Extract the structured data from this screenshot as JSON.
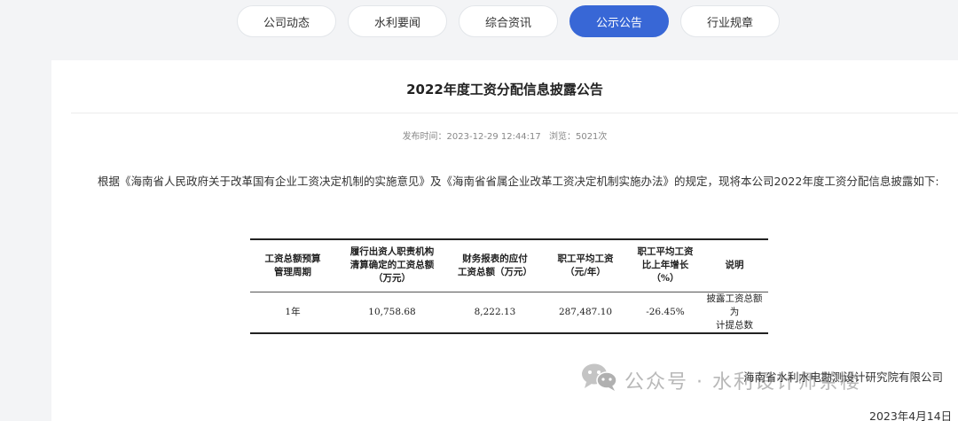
{
  "tabs": [
    {
      "label": "公司动态",
      "active": false
    },
    {
      "label": "水利要闻",
      "active": false
    },
    {
      "label": "综合资讯",
      "active": false
    },
    {
      "label": "公示公告",
      "active": true
    },
    {
      "label": "行业规章",
      "active": false
    }
  ],
  "colors": {
    "accent": "#3867d6",
    "background": "#f3f4f6"
  },
  "article": {
    "title": "2022年度工资分配信息披露公告",
    "published": "发布时间：2023-12-29 12:44:17",
    "views": "浏览：5021次",
    "paragraph": "根据《海南省人民政府关于改革国有企业工资决定机制的实施意见》及《海南省省属企业改革工资决定机制实施办法》的规定，现将本公司2022年度工资分配信息披露如下:"
  },
  "table": {
    "headers": [
      "工资总额预算\n管理周期",
      "履行出资人职责机构\n清算确定的工资总额\n（万元）",
      "财务报表的应付\n工资总额（万元）",
      "职工平均工资\n（元/年）",
      "职工平均工资\n比上年增长\n（%）",
      "说明"
    ],
    "rows": [
      [
        "1年",
        "10,758.68",
        "8,222.13",
        "287,487.10",
        "-26.45%",
        "披露工资总额为\n计提总数"
      ]
    ]
  },
  "footer": {
    "watermark": "公众号 · 水利设计师茶楼",
    "watermark_icon": "wechat-icon",
    "organization": "海南省水利水电勘测设计研究院有限公司",
    "date": "2023年4月14日"
  }
}
